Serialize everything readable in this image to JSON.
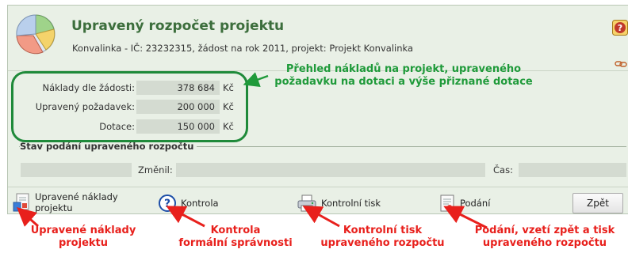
{
  "header": {
    "title": "Upravený rozpočet projektu",
    "subtitle": "Konvalinka - IČ: 23232315, žádost na rok 2011, projekt: Projekt Konvalinka",
    "help_icon": "help-icon",
    "link_icon": "chain-link-icon"
  },
  "summary": {
    "rows": [
      {
        "label": "Náklady dle žádosti:",
        "value": "378 684",
        "unit": "Kč"
      },
      {
        "label": "Upravený požadavek:",
        "value": "200 000",
        "unit": "Kč"
      },
      {
        "label": "Dotace:",
        "value": "150 000",
        "unit": "Kč"
      }
    ]
  },
  "status": {
    "title": "Stav podání upraveného rozpočtu",
    "changed_label": "Změnil:",
    "time_label": "Čas:",
    "changed_value": "",
    "time_value": "",
    "state_value": ""
  },
  "toolbar": {
    "adjusted_costs_label_line1": "Upravené náklady",
    "adjusted_costs_label_line2": "projektu",
    "check_label": "Kontrola",
    "print_label": "Kontrolní tisk",
    "submit_label": "Podání",
    "back_label": "Zpět"
  },
  "annotations": {
    "green_line1": "Přehled nákladů na projekt, upraveného",
    "green_line2": "požadavku na dotaci a výše přiznané dotace",
    "red_1_line1": "Upravené náklady",
    "red_1_line2": "projektu",
    "red_2_line1": "Kontrola",
    "red_2_line2": "formální správnosti",
    "red_3_line1": "Kontrolní tisk",
    "red_3_line2": "upraveného rozpočtu",
    "red_4_line1": "Podání, vzetí zpět a tisk",
    "red_4_line2": "upraveného rozpočtu"
  },
  "colors": {
    "title_green": "#3c6e3c",
    "annotation_green": "#1f9a3a",
    "annotation_red": "#e8201c",
    "panel_bg": "#e9f0e6",
    "field_bg": "#d4dbd1"
  }
}
